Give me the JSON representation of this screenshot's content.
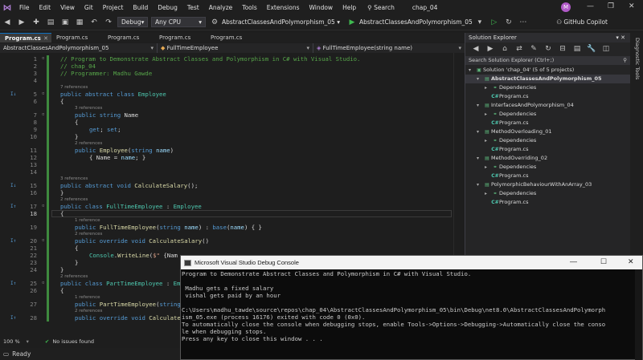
{
  "menubar": {
    "items": [
      "File",
      "Edit",
      "View",
      "Git",
      "Project",
      "Build",
      "Debug",
      "Test",
      "Analyze",
      "Tools",
      "Extensions",
      "Window",
      "Help"
    ],
    "search_label": "Search",
    "solution_name": "chap_04",
    "avatar_letter": "M"
  },
  "toolbar": {
    "config": "Debug",
    "platform": "Any CPU",
    "startup_project": "AbstractClassesAndPolymorphism_05",
    "run_label": "AbstractClassesAndPolymorphism_05",
    "copilot": "GitHub Copilot"
  },
  "tabs": [
    {
      "label": "Program.cs",
      "active": true
    },
    {
      "label": "Program.cs",
      "active": false
    },
    {
      "label": "Program.cs",
      "active": false
    },
    {
      "label": "Program.cs",
      "active": false
    },
    {
      "label": "Program.cs",
      "active": false
    }
  ],
  "navbar": {
    "project": "AbstractClassesAndPolymorphism_05",
    "class": "FullTimeEmployee",
    "member": "FullTimeEmployee(string name)"
  },
  "editor": {
    "lines": [
      {
        "n": "1",
        "tokens": [
          [
            "cm",
            "// Program to Demonstrate Abstract Classes and Polymorphism in C# with Visual Studio."
          ]
        ]
      },
      {
        "n": "2",
        "tokens": [
          [
            "cm",
            "// chap_04"
          ]
        ]
      },
      {
        "n": "3",
        "tokens": [
          [
            "cm",
            "// Programmer: Madhu Gawde"
          ]
        ]
      },
      {
        "n": "4",
        "tokens": []
      },
      {
        "n": "5",
        "ref": "7 references",
        "gm": "I↓",
        "tokens": [
          [
            "kw",
            "public abstract class "
          ],
          [
            "ty",
            "Employee"
          ]
        ]
      },
      {
        "n": "6",
        "tokens": [
          [
            "pl",
            "{"
          ]
        ]
      },
      {
        "n": "7",
        "ref": "3 references",
        "indent": 1,
        "tokens": [
          [
            "kw",
            "public string "
          ],
          [
            "pl",
            "Name"
          ]
        ]
      },
      {
        "n": "8",
        "indent": 1,
        "tokens": [
          [
            "pl",
            "{"
          ]
        ]
      },
      {
        "n": "9",
        "indent": 2,
        "tokens": [
          [
            "kw",
            "get"
          ],
          [
            "pl",
            "; "
          ],
          [
            "kw",
            "set"
          ],
          [
            "pl",
            ";"
          ]
        ]
      },
      {
        "n": "10",
        "indent": 1,
        "tokens": [
          [
            "pl",
            "}"
          ]
        ]
      },
      {
        "n": "11",
        "ref": "2 references",
        "indent": 1,
        "tokens": [
          [
            "kw",
            "public "
          ],
          [
            "fn",
            "Employee"
          ],
          [
            "pl",
            "("
          ],
          [
            "kw",
            "string "
          ],
          [
            "pm",
            "name"
          ],
          [
            "pl",
            ")"
          ]
        ]
      },
      {
        "n": "12",
        "indent": 2,
        "tokens": [
          [
            "pl",
            "{ Name = "
          ],
          [
            "pm",
            "name"
          ],
          [
            "pl",
            "; }"
          ]
        ]
      },
      {
        "n": "13",
        "tokens": []
      },
      {
        "n": "14",
        "tokens": []
      },
      {
        "n": "15",
        "ref": "3 references",
        "gm": "I↓",
        "tokens": [
          [
            "kw",
            "public abstract void "
          ],
          [
            "fn",
            "CalculateSalary"
          ],
          [
            "pl",
            "();"
          ]
        ]
      },
      {
        "n": "16",
        "tokens": [
          [
            "pl",
            "}"
          ]
        ]
      },
      {
        "n": "17",
        "ref": "2 references",
        "gm": "I↑",
        "tokens": [
          [
            "kw",
            "public class "
          ],
          [
            "ty",
            "FullTimeEmployee"
          ],
          [
            "pl",
            " : "
          ],
          [
            "ty",
            "Employee"
          ]
        ]
      },
      {
        "n": "18",
        "cur": true,
        "tokens": [
          [
            "pl",
            "{"
          ]
        ]
      },
      {
        "n": "19",
        "ref": "1 reference",
        "indent": 1,
        "tokens": [
          [
            "kw",
            "public "
          ],
          [
            "fn",
            "FullTimeEmployee"
          ],
          [
            "pl",
            "("
          ],
          [
            "kw",
            "string "
          ],
          [
            "pm",
            "name"
          ],
          [
            "pl",
            ") : "
          ],
          [
            "kw",
            "base"
          ],
          [
            "pl",
            "("
          ],
          [
            "pm",
            "name"
          ],
          [
            "pl",
            ") { }"
          ]
        ]
      },
      {
        "n": "20",
        "ref": "2 references",
        "gm": "I↑",
        "indent": 1,
        "tokens": [
          [
            "kw",
            "public override void "
          ],
          [
            "fn",
            "CalculateSalary"
          ],
          [
            "pl",
            "()"
          ]
        ]
      },
      {
        "n": "21",
        "indent": 1,
        "tokens": [
          [
            "pl",
            "{"
          ]
        ]
      },
      {
        "n": "22",
        "indent": 2,
        "tokens": [
          [
            "ty",
            "Console"
          ],
          [
            "pl",
            "."
          ],
          [
            "fn",
            "WriteLine"
          ],
          [
            "pl",
            "("
          ],
          [
            "st",
            "$\" "
          ],
          [
            "pl",
            "{Nam"
          ]
        ]
      },
      {
        "n": "23",
        "indent": 1,
        "tokens": [
          [
            "pl",
            "}"
          ]
        ]
      },
      {
        "n": "24",
        "tokens": [
          [
            "pl",
            "}"
          ]
        ]
      },
      {
        "n": "25",
        "ref": "2 references",
        "gm": "I↑",
        "tokens": [
          [
            "kw",
            "public class "
          ],
          [
            "ty",
            "PartTimeEmployee"
          ],
          [
            "pl",
            " : "
          ],
          [
            "ty",
            "Em"
          ]
        ]
      },
      {
        "n": "26",
        "tokens": [
          [
            "pl",
            "{"
          ]
        ]
      },
      {
        "n": "27",
        "ref": "1 reference",
        "indent": 1,
        "tokens": [
          [
            "kw",
            "public "
          ],
          [
            "fn",
            "PartTimeEmployee"
          ],
          [
            "pl",
            "("
          ],
          [
            "kw",
            "string "
          ],
          [
            "pm",
            "na"
          ]
        ]
      },
      {
        "n": "28",
        "ref": "2 references",
        "gm": "I↑",
        "indent": 1,
        "tokens": [
          [
            "kw",
            "public override void "
          ],
          [
            "fn",
            "Calculate"
          ]
        ]
      }
    ]
  },
  "editor_status": {
    "zoom": "100 %",
    "issues": "No issues found"
  },
  "statusbar": {
    "ready": "Ready"
  },
  "solution_explorer": {
    "title": "Solution Explorer",
    "search_placeholder": "Search Solution Explorer (Ctrl+;)",
    "diagnostic_tools": "Diagnostic Tools",
    "items": [
      {
        "label": "Solution 'chap_04' (5 of 5 projects)",
        "level": 0,
        "kind": "solution"
      },
      {
        "label": "AbstractClassesAndPolymorphism_05",
        "level": 1,
        "kind": "project",
        "bold": true
      },
      {
        "label": "Dependencies",
        "level": 2,
        "kind": "deps"
      },
      {
        "label": "Program.cs",
        "level": 2,
        "kind": "cs"
      },
      {
        "label": "InterfacesAndPolymorphism_04",
        "level": 1,
        "kind": "project"
      },
      {
        "label": "Dependencies",
        "level": 2,
        "kind": "deps"
      },
      {
        "label": "Program.cs",
        "level": 2,
        "kind": "cs"
      },
      {
        "label": "MethodOverloading_01",
        "level": 1,
        "kind": "project"
      },
      {
        "label": "Dependencies",
        "level": 2,
        "kind": "deps"
      },
      {
        "label": "Program.cs",
        "level": 2,
        "kind": "cs"
      },
      {
        "label": "MethodOverriding_02",
        "level": 1,
        "kind": "project"
      },
      {
        "label": "Dependencies",
        "level": 2,
        "kind": "deps"
      },
      {
        "label": "Program.cs",
        "level": 2,
        "kind": "cs"
      },
      {
        "label": "PolymorphicBehaviourWithAnArray_03",
        "level": 1,
        "kind": "project"
      },
      {
        "label": "Dependencies",
        "level": 2,
        "kind": "deps"
      },
      {
        "label": "Program.cs",
        "level": 2,
        "kind": "cs"
      }
    ]
  },
  "console": {
    "title": "Microsoft Visual Studio Debug Console",
    "lines": [
      "Program to Demonstrate Abstract Classes and Polymorphism in C# with Visual Studio.",
      "",
      " Madhu gets a fixed salary",
      " vishal gets paid by an hour",
      "",
      "C:\\Users\\madhu_tawde\\source\\repos\\chap_04\\AbstractClassesAndPolymorphism_05\\bin\\Debug\\net8.0\\AbstractClassesAndPolymorph",
      "ism_05.exe (process 16176) exited with code 0 (0x0).",
      "To automatically close the console when debugging stops, enable Tools->Options->Debugging->Automatically close the conso",
      "le when debugging stops.",
      "Press any key to close this window . . ."
    ]
  }
}
